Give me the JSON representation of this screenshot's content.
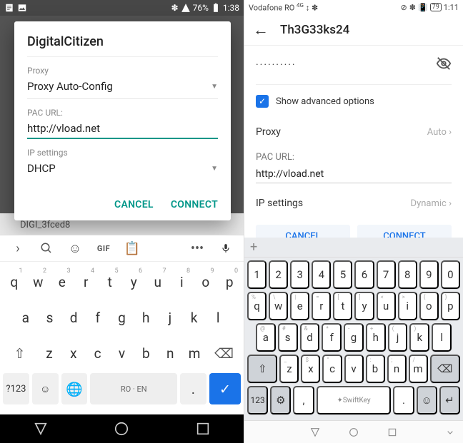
{
  "left": {
    "status": {
      "battery": "76%",
      "time": "1:38"
    },
    "bg_item": "DIGI_3fced8",
    "dialog": {
      "title": "DigitalCitizen",
      "proxy_label": "Proxy",
      "proxy_value": "Proxy Auto-Config",
      "pac_label": "PAC URL:",
      "pac_value": "http://vload.net",
      "ip_label": "IP settings",
      "ip_value": "DHCP",
      "cancel": "CANCEL",
      "connect": "CONNECT"
    },
    "keyboard": {
      "gif": "GIF",
      "row1": [
        "q",
        "w",
        "e",
        "r",
        "t",
        "y",
        "u",
        "i",
        "o",
        "p"
      ],
      "row1_sup": [
        "1",
        "2",
        "3",
        "4",
        "5",
        "6",
        "7",
        "8",
        "9",
        "0"
      ],
      "row2": [
        "a",
        "s",
        "d",
        "f",
        "g",
        "h",
        "j",
        "k",
        "l"
      ],
      "row3": [
        "z",
        "x",
        "c",
        "v",
        "b",
        "n",
        "m"
      ],
      "sym": "?123",
      "space": "RO · EN",
      "dot": "."
    }
  },
  "right": {
    "status": {
      "carrier": "Vodafone RO",
      "time": "1:11",
      "battery": "79"
    },
    "title": "Th3G33ks24",
    "password_mask": "··········",
    "show_adv": "Show advanced options",
    "proxy_label": "Proxy",
    "proxy_value": "Auto",
    "pac_label": "PAC URL:",
    "pac_value": "http://vload.net",
    "ip_label": "IP settings",
    "ip_value": "Dynamic",
    "cancel": "CANCEL",
    "connect": "CONNECT",
    "keyboard": {
      "nums": [
        "1",
        "2",
        "3",
        "4",
        "5",
        "6",
        "7",
        "8",
        "9",
        "0"
      ],
      "row1": [
        "q",
        "w",
        "e",
        "r",
        "t",
        "y",
        "u",
        "i",
        "o",
        "p"
      ],
      "row1_sub": [
        "%",
        "\\",
        "|",
        "=",
        "[",
        "]",
        "<",
        ">",
        "{",
        "}"
      ],
      "row2": [
        "a",
        "s",
        "d",
        "f",
        "g",
        "h",
        "j",
        "k",
        "l"
      ],
      "row2_sub": [
        "@",
        "#",
        "&",
        "*",
        "-",
        "+",
        "(",
        ")",
        ""
      ],
      "row3": [
        "z",
        "x",
        "c",
        "v",
        "b",
        "n",
        "m"
      ],
      "row3_sub": [
        "_",
        "$",
        "\"",
        "'",
        ":",
        ";",
        "/"
      ],
      "sym": "123",
      "comma": ",",
      "dot": ".",
      "space": "SwiftKey"
    }
  }
}
